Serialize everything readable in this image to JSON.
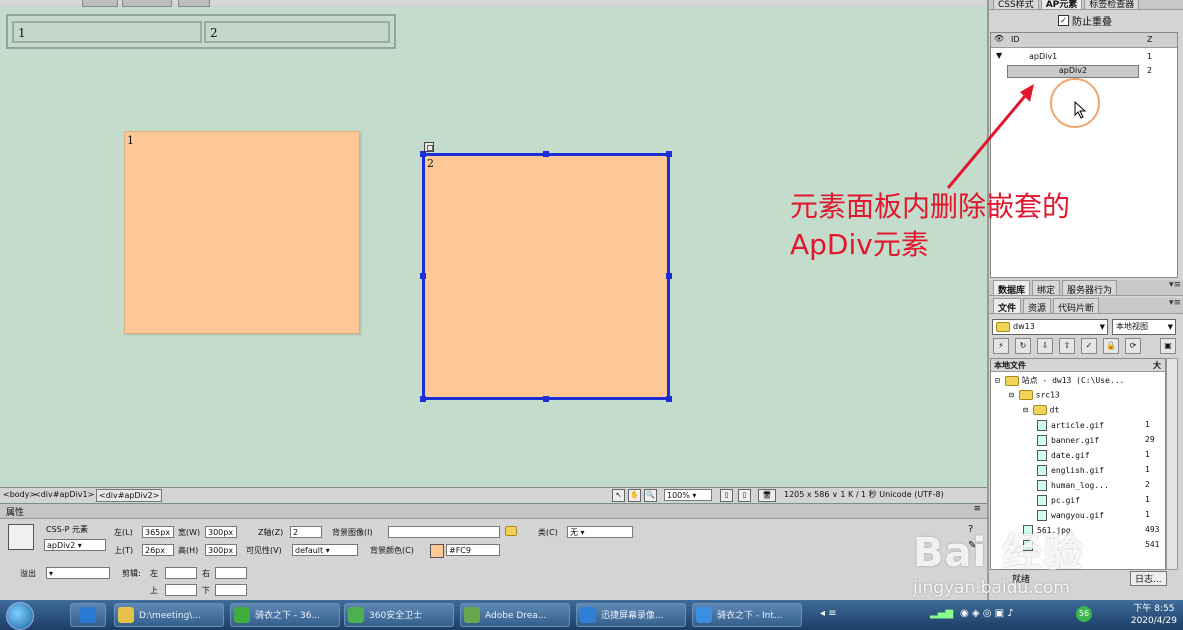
{
  "canvas": {
    "table_cells": [
      "1",
      "2"
    ],
    "apdiv1_label": "1",
    "apdiv2_label": "2"
  },
  "right_panel": {
    "top_tabs": [
      "CSS样式",
      "AP元素",
      "标签检查器"
    ],
    "prevent_overlap": "防止重叠",
    "ap_header": {
      "eye": "",
      "id": "ID",
      "z": "Z"
    },
    "ap_rows": [
      {
        "name": "apDiv1",
        "z": "1"
      },
      {
        "name": "apDiv2",
        "z": "2"
      }
    ],
    "mid_tabs": [
      "数据库",
      "绑定",
      "服务器行为"
    ],
    "file_tabs": [
      "文件",
      "资源",
      "代码片断"
    ],
    "site_combo": "dw13",
    "view_combo": "本地视图",
    "tree_header": "本地文件",
    "tree_header_size": "大",
    "tree": [
      {
        "name": "站点 - dw13 (C:\\Use...",
        "size": "",
        "indent": 0,
        "kind": "site"
      },
      {
        "name": "src13",
        "size": "",
        "indent": 1,
        "kind": "folder"
      },
      {
        "name": "dt",
        "size": "",
        "indent": 2,
        "kind": "folder"
      },
      {
        "name": "article.gif",
        "size": "1",
        "indent": 3,
        "kind": "file"
      },
      {
        "name": "banner.gif",
        "size": "29",
        "indent": 3,
        "kind": "file"
      },
      {
        "name": "date.gif",
        "size": "1",
        "indent": 3,
        "kind": "file"
      },
      {
        "name": "english.gif",
        "size": "1",
        "indent": 3,
        "kind": "file"
      },
      {
        "name": "human_log...",
        "size": "2",
        "indent": 3,
        "kind": "file"
      },
      {
        "name": "pc.gif",
        "size": "1",
        "indent": 3,
        "kind": "file"
      },
      {
        "name": "wangyou.gif",
        "size": "1",
        "indent": 3,
        "kind": "file"
      },
      {
        "name": "561.jpg",
        "size": "493",
        "indent": 2,
        "kind": "file"
      },
      {
        "name": "",
        "size": "541",
        "indent": 2,
        "kind": "file"
      }
    ],
    "bottom_left": "就绪",
    "bottom_right": "日志..."
  },
  "annotation": {
    "line1": "元素面板内删除嵌套的",
    "line2": "ApDiv元素",
    "color": "#e2162d"
  },
  "status_bar": {
    "tags": [
      "<body>",
      "<div#apDiv1>",
      "<div#apDiv2>"
    ],
    "zoom": "100%",
    "info": "1205 x 586 ∨ 1 K / 1 秒 Unicode (UTF-8)"
  },
  "properties": {
    "title": "属性",
    "element_type": "CSS-P 元素",
    "id_value": "apDiv2",
    "left_label": "左(L)",
    "left_value": "365px",
    "width_label": "宽(W)",
    "width_value": "300px",
    "top_label": "上(T)",
    "top_value": "26px",
    "height_label": "高(H)",
    "height_value": "300px",
    "z_label": "Z轴(Z)",
    "z_value": "2",
    "vis_label": "可见性(V)",
    "vis_value": "default",
    "bgimg_label": "背景图像(I)",
    "bgimg_value": "",
    "bgcolor_label": "背景颜色(C)",
    "bgcolor_value": "#FC9",
    "class_label": "类(C)",
    "class_value": "无",
    "overflow_label": "溢出",
    "overflow_value": "",
    "clip_label": "剪辑:",
    "clip_left": "左",
    "clip_right": "右",
    "clip_top": "上",
    "clip_bottom": "下"
  },
  "taskbar": {
    "items": [
      {
        "label": "D:\\meeting\\...",
        "color": "#e7c24a"
      },
      {
        "label": "骑衣之下 - 36...",
        "color": "#3fae3f"
      },
      {
        "label": "360安全卫士",
        "color": "#4caf50"
      },
      {
        "label": "Adobe Drea...",
        "color": "#6aa84f"
      },
      {
        "label": "迅捷屏幕录像...",
        "color": "#2f7fd8"
      },
      {
        "label": "骑衣之下 - Int...",
        "color": "#3b8fe0"
      }
    ],
    "time": "下午 8:55",
    "date": "2020/4/29"
  },
  "watermark": {
    "brand": "Bai 经验",
    "url": "jingyan.baidu.com"
  },
  "colors": {
    "canvas_bg": "#c3dccb",
    "apdiv_bg": "#fdc896",
    "selection_border": "#1c2ed8"
  }
}
